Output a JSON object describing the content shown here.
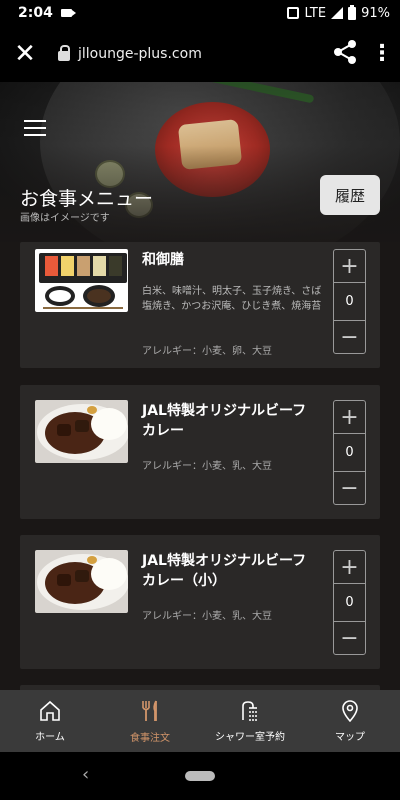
{
  "status_bar": {
    "time": "2:04",
    "network": "LTE",
    "battery": "91%"
  },
  "browser": {
    "url": "jllounge-plus.com",
    "icons": [
      "close-icon",
      "lock-icon",
      "share-icon",
      "more-vert-icon"
    ]
  },
  "header": {
    "title": "お食事メニュー",
    "subtitle": "画像はイメージです",
    "history_label": "履歴"
  },
  "menu_items": [
    {
      "name": "和御膳",
      "description": "白米、味噌汁、明太子、玉子焼き、さば塩焼き、かつお沢庵、ひじき煮、焼海苔",
      "allergy": "アレルギー：小麦、卵、大豆",
      "quantity": "0"
    },
    {
      "name_line1": "JAL特製オリジナルビーフ",
      "name_line2": "カレー",
      "description": "",
      "allergy": "アレルギー：小麦、乳、大豆",
      "quantity": "0"
    },
    {
      "name_line1": "JAL特製オリジナルビーフ",
      "name_line2": "カレー（小）",
      "description": "",
      "allergy": "アレルギー：小麦、乳、大豆",
      "quantity": "0"
    }
  ],
  "stepper": {
    "plus": "+",
    "minus": "−"
  },
  "bottom_nav": {
    "items": [
      {
        "label": "ホーム",
        "icon": "home-icon"
      },
      {
        "label": "食事注文",
        "icon": "fork-knife-icon",
        "active": true
      },
      {
        "label": "シャワー室予約",
        "icon": "shower-icon"
      },
      {
        "label": "マップ",
        "icon": "map-pin-icon"
      }
    ]
  },
  "colors": {
    "active_nav": "#d2956a",
    "card_bg": "#2a2827",
    "page_bg": "#1a1716",
    "nav_bg": "#3a3a3a"
  }
}
